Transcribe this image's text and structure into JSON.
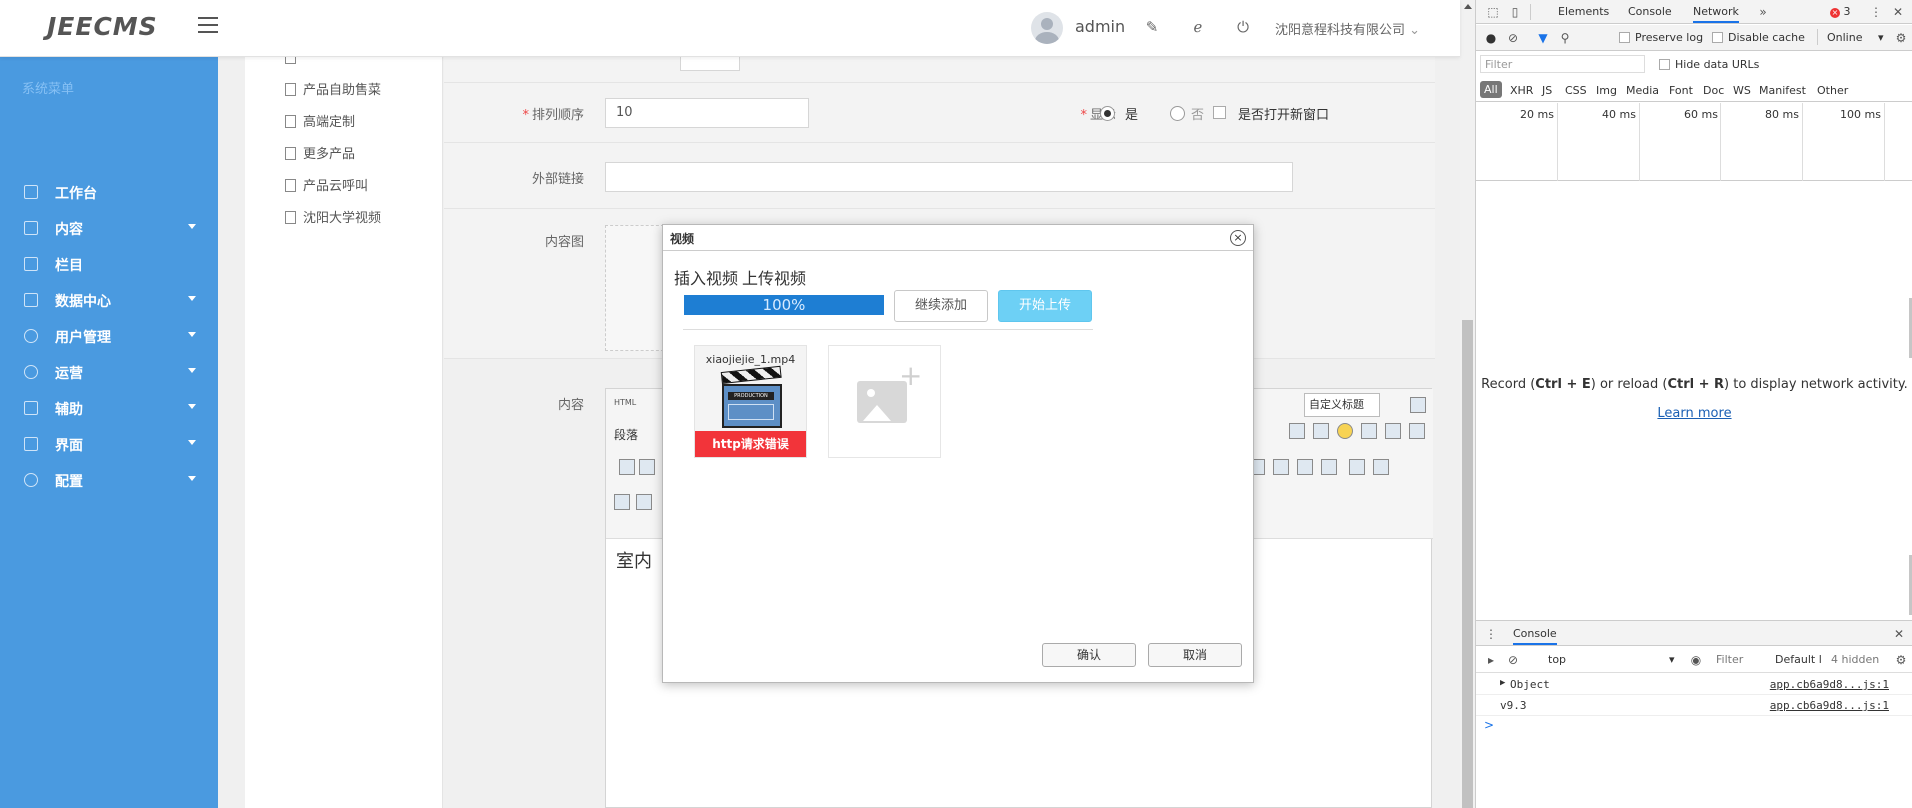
{
  "app": {
    "logo": "JEECMS",
    "user": "admin",
    "company": "沈阳意程科技有限公司"
  },
  "sidebar": {
    "title": "系统菜单",
    "items": [
      {
        "label": "工作台",
        "has_arrow": false
      },
      {
        "label": "内容",
        "has_arrow": true
      },
      {
        "label": "栏目",
        "has_arrow": false
      },
      {
        "label": "数据中心",
        "has_arrow": true
      },
      {
        "label": "用户管理",
        "has_arrow": true
      },
      {
        "label": "运营",
        "has_arrow": true
      },
      {
        "label": "辅助",
        "has_arrow": true
      },
      {
        "label": "界面",
        "has_arrow": true
      },
      {
        "label": "配置",
        "has_arrow": true
      }
    ]
  },
  "tree": {
    "items": [
      "产品自助售菜",
      "高端定制",
      "更多产品",
      "产品云呼叫",
      "沈阳大学视频"
    ]
  },
  "form": {
    "sort_label": "排列顺序",
    "sort_value": "10",
    "display_label": "显示",
    "yes_label": "是",
    "no_label": "否",
    "new_window_label": "是否打开新窗口",
    "link_label": "外部链接",
    "image_label": "内容图",
    "content_label": "内容",
    "editor_format": "段落",
    "editor_custom": "自定义标题",
    "editor_html": "HTML",
    "editor_text": "室内"
  },
  "dialog": {
    "title": "视频",
    "tab_insert": "插入视频",
    "tab_upload": "上传视频",
    "progress_text": "100%",
    "progress_value": 1.0,
    "continue_btn": "继续添加",
    "start_btn": "开始上传",
    "file_name": "xiaojiejie_1.mp4",
    "file_error": "http请求错误",
    "clapper_text": "PRODUCTION",
    "ok_btn": "确认",
    "cancel_btn": "取消"
  },
  "devtools": {
    "tabs": [
      "Elements",
      "Console",
      "Network"
    ],
    "active_tab": "Network",
    "error_count": "3",
    "preserve_log": "Preserve log",
    "disable_cache": "Disable cache",
    "online": "Online",
    "filter_placeholder": "Filter",
    "hide_data_urls": "Hide data URLs",
    "types": [
      "All",
      "XHR",
      "JS",
      "CSS",
      "Img",
      "Media",
      "Font",
      "Doc",
      "WS",
      "Manifest",
      "Other"
    ],
    "timeline_labels": [
      "20 ms",
      "40 ms",
      "60 ms",
      "80 ms",
      "100 ms"
    ],
    "record_msg_pre": "Record (",
    "record_key1": "Ctrl + E",
    "record_msg_mid": ") or reload (",
    "record_key2": "Ctrl + R",
    "record_msg_post": ") to display network activity.",
    "learn_more": "Learn more",
    "console_title": "Console",
    "context": "top",
    "console_filter": "Filter",
    "levels": "Default l",
    "hidden": "4 hidden",
    "console_lines": [
      {
        "text": "Object",
        "src": "app.cb6a9d8...js:1",
        "expandable": true
      },
      {
        "text": "v9.3",
        "src": "app.cb6a9d8...js:1",
        "expandable": false
      }
    ],
    "prompt": ">"
  }
}
